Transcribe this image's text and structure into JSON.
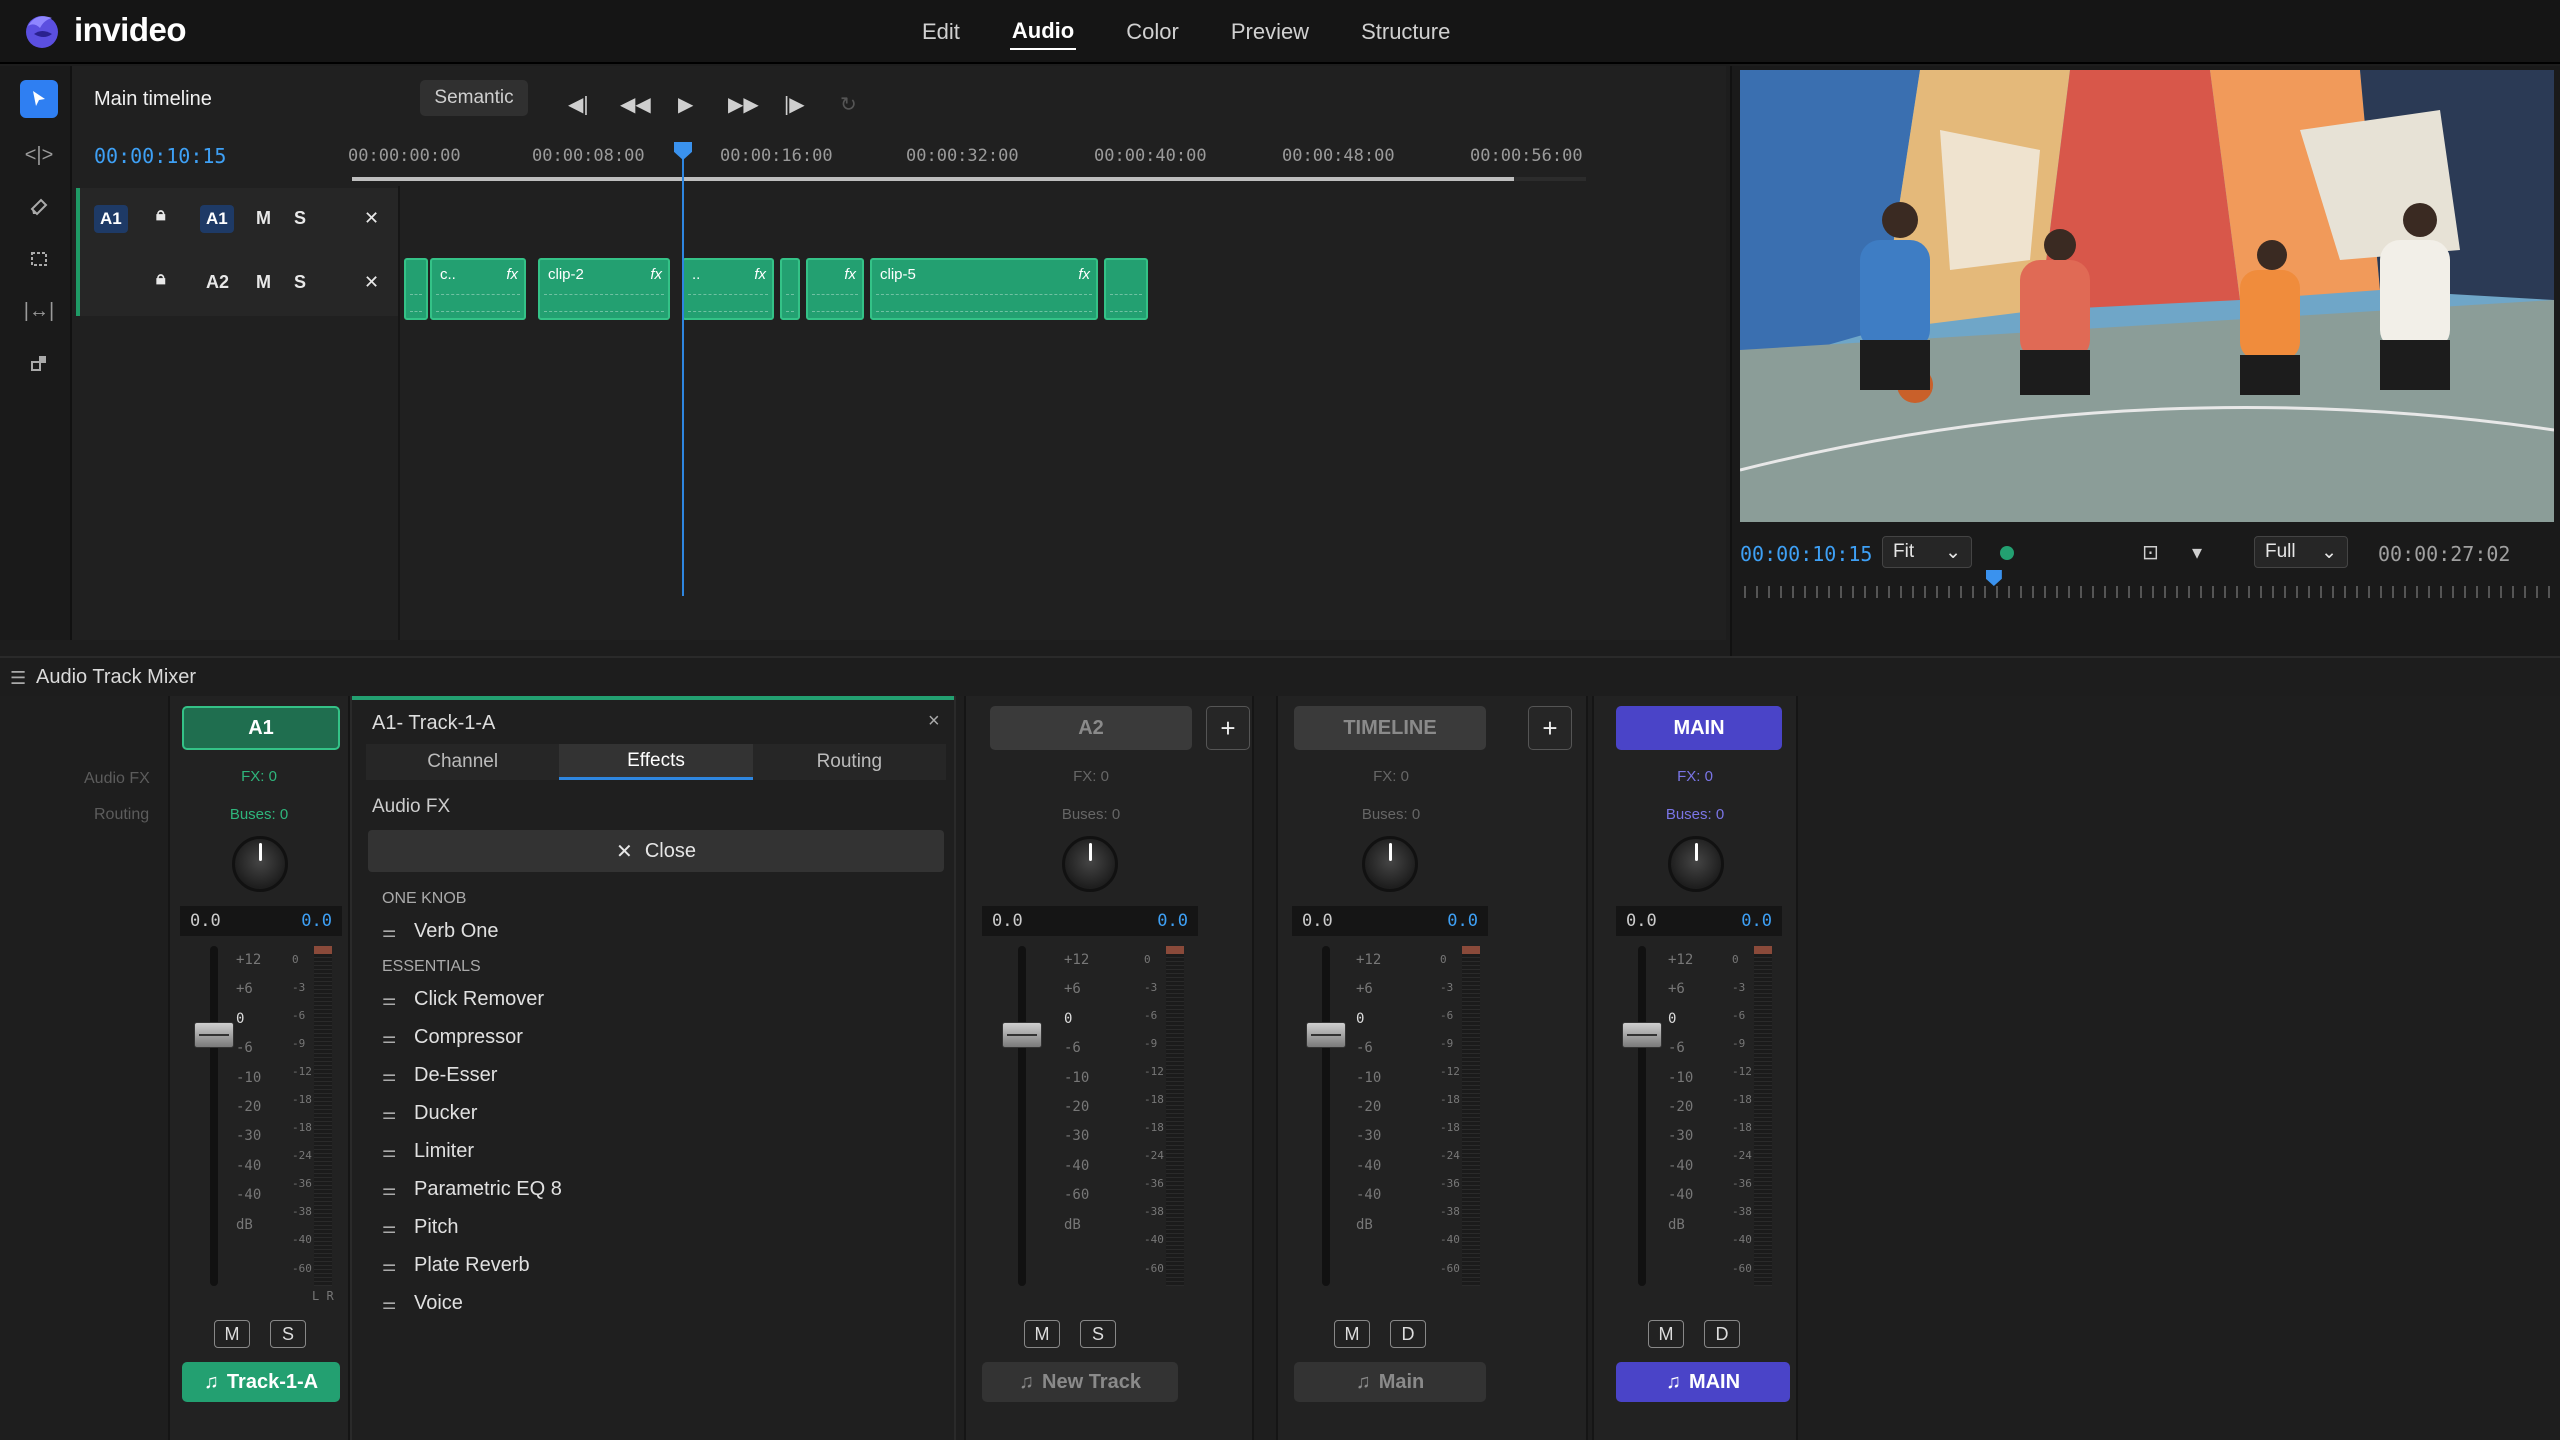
{
  "app": {
    "name": "invideo"
  },
  "nav": [
    "Edit",
    "Audio",
    "Color",
    "Preview",
    "Structure"
  ],
  "nav_active": "Audio",
  "timeline": {
    "title": "Main timeline",
    "mode_button": "Semantic",
    "timecode": "00:00:10:15",
    "ruler": [
      "00:00:00:00",
      "00:00:08:00",
      "00:00:16:00",
      "00:00:32:00",
      "00:00:40:00",
      "00:00:48:00",
      "00:00:56:00"
    ],
    "tracks": [
      {
        "label": "A1",
        "badge": "A1",
        "m": "M",
        "s": "S"
      },
      {
        "label": "A2",
        "m": "M",
        "s": "S"
      }
    ],
    "clips": [
      {
        "label": "c..",
        "fx": "fx"
      },
      {
        "label": "clip-2",
        "fx": "fx"
      },
      {
        "label": "..",
        "fx": "fx"
      },
      {
        "label": "",
        "fx": ""
      },
      {
        "label": "",
        "fx": "fx"
      },
      {
        "label": "clip-5",
        "fx": "fx"
      },
      {
        "label": "",
        "fx": ""
      }
    ]
  },
  "preview": {
    "timecode": "00:00:10:15",
    "fit": "Fit",
    "quality": "Full",
    "duration": "00:00:27:02",
    "playhead_fraction": 0.31
  },
  "mixer": {
    "title": "Audio Track Mixer",
    "side_labels": [
      "Audio FX",
      "Routing"
    ],
    "scale_left": [
      "+12",
      "+6",
      "0",
      "-6",
      "-10",
      "-20",
      "-30",
      "-40",
      "-40",
      "dB"
    ],
    "scale_left_alt": [
      "+12",
      "+6",
      "0",
      "-6",
      "-10",
      "-20",
      "-30",
      "-40",
      "-60",
      "dB"
    ],
    "scale_right": [
      "0",
      "-3",
      "-6",
      "-9",
      "-12",
      "-18",
      "-18",
      "-24",
      "-36",
      "-38",
      "-40",
      "-60",
      "L",
      "R"
    ],
    "strips": [
      {
        "name": "A1",
        "fx": "FX: 0",
        "buses": "Buses: 0",
        "val_left": "0.0",
        "val_right": "0.0",
        "m": "M",
        "s": "S",
        "track": "Track-1-A"
      },
      {
        "name": "A2",
        "fx": "FX: 0",
        "buses": "Buses: 0",
        "val_left": "0.0",
        "val_right": "0.0",
        "m": "M",
        "s": "S",
        "track": "New Track"
      },
      {
        "name": "TIMELINE",
        "fx": "FX: 0",
        "buses": "Buses: 0",
        "val_left": "0.0",
        "val_right": "0.0",
        "m": "M",
        "s": "D",
        "track": "Main"
      },
      {
        "name": "MAIN",
        "fx": "FX: 0",
        "buses": "Buses: 0",
        "val_left": "0.0",
        "val_right": "0.0",
        "m": "M",
        "s": "D",
        "track": "MAIN"
      }
    ],
    "plus": "+",
    "fx_panel": {
      "title": "A1- Track-1-A",
      "close_x": "×",
      "tabs": [
        "Channel",
        "Effects",
        "Routing"
      ],
      "active_tab": "Effects",
      "section": "Audio FX",
      "close_label": "Close",
      "groups": [
        {
          "name": "ONE KNOB",
          "items": [
            "Verb One"
          ]
        },
        {
          "name": "ESSENTIALS",
          "items": [
            "Click Remover",
            "Compressor",
            "De-Esser",
            "Ducker",
            "Limiter",
            "Parametric EQ 8",
            "Pitch",
            "Plate Reverb",
            "Voice"
          ]
        }
      ]
    }
  },
  "colors": {
    "accent_green": "#23a071",
    "accent_blue": "#2e86e0",
    "main_purple": "#4a44c8"
  }
}
